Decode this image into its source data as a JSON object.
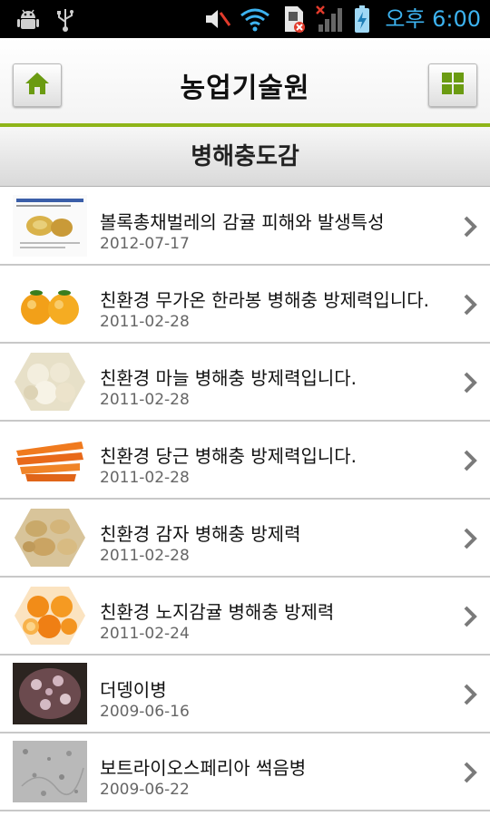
{
  "status_bar": {
    "time": "오후 6:00",
    "icons": [
      "android-debug-icon",
      "usb-icon",
      "volume-muted-icon",
      "wifi-icon",
      "sim-error-icon",
      "signal-icon",
      "battery-charging-icon"
    ]
  },
  "header": {
    "title": "농업기술원",
    "home_icon": "home-icon",
    "menu_icon": "grid-menu-icon"
  },
  "section": {
    "title": "병해충도감"
  },
  "list": [
    {
      "title": "볼록총채벌레의 감귤 피해와 발생특성",
      "date": "2012-07-17",
      "thumb": "document"
    },
    {
      "title": "친환경 무가온 한라봉 병해충 방제력입니다.",
      "date": "2011-02-28",
      "thumb": "hallabong"
    },
    {
      "title": "친환경 마늘 병해충 방제력입니다.",
      "date": "2011-02-28",
      "thumb": "garlic"
    },
    {
      "title": "친환경 당근 병해충 방제력입니다.",
      "date": "2011-02-28",
      "thumb": "carrot"
    },
    {
      "title": "친환경 감자 병해충 방제력",
      "date": "2011-02-28",
      "thumb": "potato"
    },
    {
      "title": "친환경 노지감귤 병해충 방제력",
      "date": "2011-02-24",
      "thumb": "tangerine"
    },
    {
      "title": "더뎅이병",
      "date": "2009-06-16",
      "thumb": "petri"
    },
    {
      "title": "보트라이오스페리아 썩음병",
      "date": "2009-06-22",
      "thumb": "microscope"
    }
  ],
  "colors": {
    "accent_green": "#8fb519",
    "icon_green": "#6b9b12",
    "status_blue": "#3db3f0"
  }
}
